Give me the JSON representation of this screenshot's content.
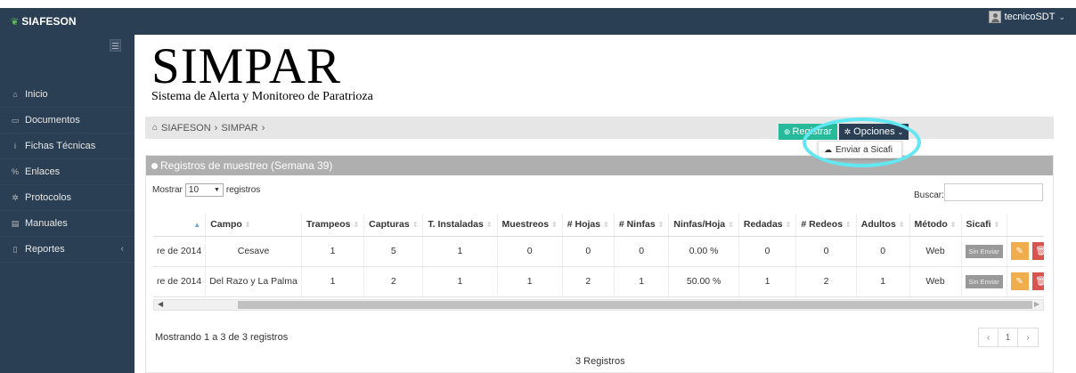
{
  "app": {
    "brand": "SIAFESON",
    "user": "tecnicoSDT"
  },
  "sidebar": {
    "items": [
      {
        "icon": "home-icon",
        "glyph": "⌂",
        "label": "Inicio"
      },
      {
        "icon": "folder-icon",
        "glyph": "▭",
        "label": "Documentos"
      },
      {
        "icon": "info-icon",
        "glyph": "i",
        "label": "Fichas Técnicas"
      },
      {
        "icon": "link-icon",
        "glyph": "%",
        "label": "Enlaces"
      },
      {
        "icon": "gear-icon",
        "glyph": "✲",
        "label": "Protocolos"
      },
      {
        "icon": "book-icon",
        "glyph": "▤",
        "label": "Manuales"
      },
      {
        "icon": "file-icon",
        "glyph": "▯",
        "label": "Reportes"
      }
    ]
  },
  "header": {
    "title": "SIMPAR",
    "subtitle": "Sistema de Alerta y Monitoreo de Paratrioza"
  },
  "breadcrumb": {
    "root": "SIAFESON",
    "current": "SIMPAR"
  },
  "panel": {
    "title": "Registros de muestreo (Semana 39)",
    "registrar_label": "Registrar",
    "opciones_label": "Opciones",
    "dropdown_item": "Enviar a Sicafi"
  },
  "controls": {
    "show_label": "Mostrar",
    "page_size": "10",
    "records_label": "registros",
    "search_label": "Buscar:"
  },
  "table": {
    "headers": [
      "",
      "Campo",
      "Trampeos",
      "Capturas",
      "T. Instaladas",
      "Muestreos",
      "# Hojas",
      "# Ninfas",
      "Ninfas/Hoja",
      "Redadas",
      "# Redeos",
      "Adultos",
      "Método",
      "Sicafi",
      ""
    ],
    "rows": [
      [
        "re de 2014",
        "Cesave",
        "1",
        "5",
        "1",
        "0",
        "0",
        "0",
        "0.00 %",
        "0",
        "0",
        "0",
        "Web",
        "Sin Enviar"
      ],
      [
        "re de 2014",
        "Del Razo y La Palma",
        "1",
        "2",
        "1",
        "1",
        "2",
        "1",
        "50.00 %",
        "1",
        "2",
        "1",
        "Web",
        "Sin Enviar"
      ]
    ]
  },
  "footer": {
    "info": "Mostrando 1 a 3 de 3 registros",
    "page": "1",
    "total": "3 Registros"
  }
}
